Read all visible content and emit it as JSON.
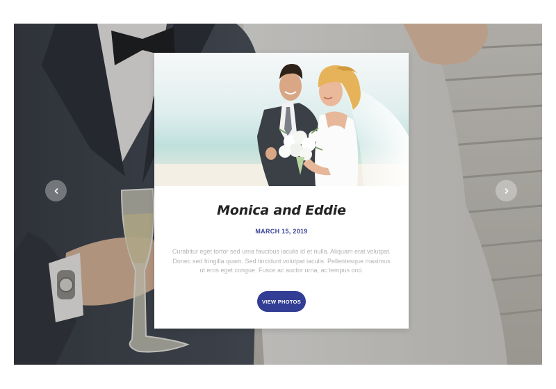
{
  "slider": {
    "prev_icon": "chevron-left-icon",
    "next_icon": "chevron-right-icon"
  },
  "card": {
    "title": "Monica and Eddie",
    "date": "MARCH 15, 2019",
    "text": "Curabitur eget tortor sed urna faucibus iaculis id et nulla. Aliquam erat volutpat. Donec sed fringilla quam. Sed tincidunt volutpat iaculis. Pellentesque maximus ut eros eget congue. Fusce ac auctor urna, ac tempus orci.",
    "button_label": "VIEW PHOTOS"
  },
  "colors": {
    "accent": "#323d94",
    "date": "#3a4396"
  }
}
